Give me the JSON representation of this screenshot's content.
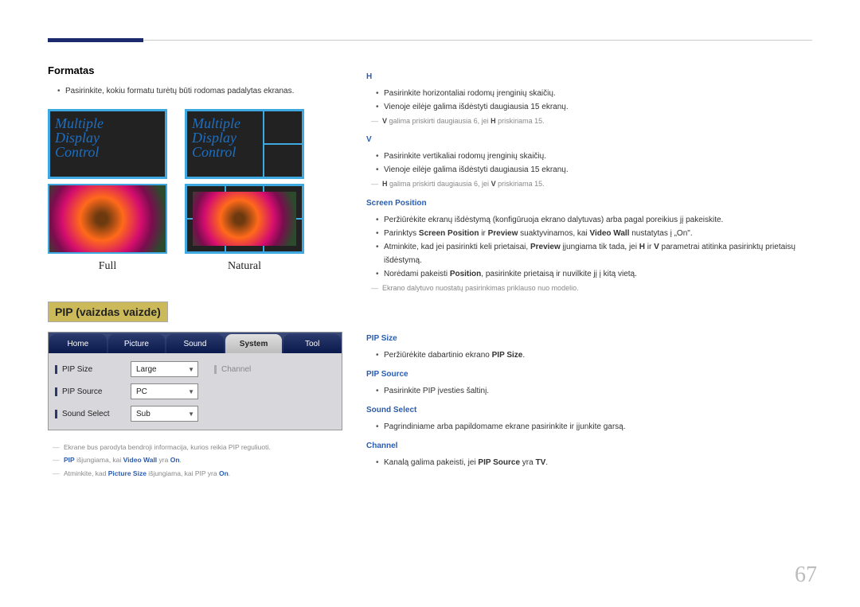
{
  "page_number": "67",
  "left": {
    "heading_formatas": "Formatas",
    "formatas_item": "Pasirinkite, kokiu formatu turėtų būti rodomas padalytas ekranas.",
    "mdc_text": "Multiple\nDisplay\nControl",
    "caption_full": "Full",
    "caption_natural": "Natural",
    "pip_tag": "PIP (vaizdas vaizde)",
    "osd": {
      "tabs": [
        "Home",
        "Picture",
        "Sound",
        "System",
        "Tool"
      ],
      "active_tab": 3,
      "rows": [
        {
          "label": "PIP Size",
          "value": "Large",
          "disabled_label": "Channel"
        },
        {
          "label": "PIP Source",
          "value": "PC"
        },
        {
          "label": "Sound Select",
          "value": "Sub"
        }
      ]
    },
    "notes": [
      {
        "t": "Ekrane bus parodyta bendroji informacija, kurios reikia PIP reguliuoti."
      },
      {
        "t": "PIP išjungiama, kai Video Wall yra On.",
        "blue": [
          "PIP",
          "Video Wall",
          "On"
        ]
      },
      {
        "t": "Atminkite, kad Picture Size išjungiama, kai PIP yra On.",
        "blue": [
          "Picture Size",
          "On"
        ]
      }
    ]
  },
  "right": {
    "h": {
      "heading": "H",
      "items": [
        "Pasirinkite horizontaliai rodomų įrenginių skaičių.",
        "Vienoje eilėje galima išdėstyti daugiausia 15 ekranų."
      ],
      "note": "V galima priskirti daugiausia 6, jei H priskiriama 15."
    },
    "v": {
      "heading": "V",
      "items": [
        "Pasirinkite vertikaliai rodomų įrenginių skaičių.",
        "Vienoje eilėje galima išdėstyti daugiausia 15 ekranų."
      ],
      "note": "H galima priskirti daugiausia 6, jei V priskiriama 15."
    },
    "sp": {
      "heading": "Screen Position",
      "items": [
        "Peržiūrėkite ekranų išdėstymą (konfigūruoja ekrano dalytuvas) arba pagal poreikius jį pakeiskite.",
        "Parinktys Screen Position ir Preview suaktyvinamos, kai Video Wall nustatytas į „On“.",
        "Atminkite, kad jei pasirinkti keli prietaisai, Preview įjungiama tik tada, jei H ir V parametrai atitinka pasirinktų prietaisų išdėstymą.",
        "Norėdami pakeisti Position, pasirinkite prietaisą ir nuvilkite jį į kitą vietą."
      ],
      "note": "Ekrano dalytuvo nuostatų pasirinkimas priklauso nuo modelio."
    },
    "pip_size": {
      "heading": "PIP Size",
      "item": "Peržiūrėkite dabartinio ekrano PIP Size."
    },
    "pip_source": {
      "heading": "PIP Source",
      "item": "Pasirinkite PIP įvesties šaltinį."
    },
    "sound_select": {
      "heading": "Sound Select",
      "item": "Pagrindiniame arba papildomame ekrane pasirinkite ir įjunkite garsą."
    },
    "channel": {
      "heading": "Channel",
      "item": "Kanalą galima pakeisti, jei PIP Source yra TV."
    }
  }
}
